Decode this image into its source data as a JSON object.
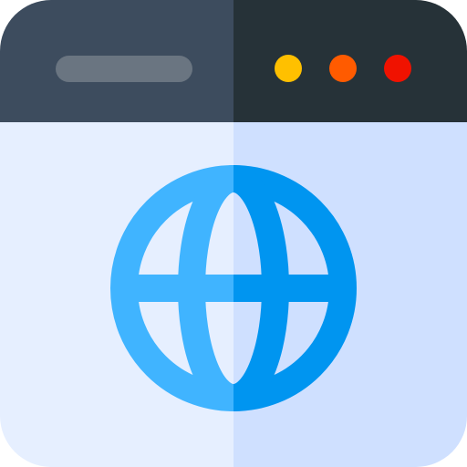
{
  "icon": {
    "name": "web-browser-globe-icon",
    "colors": {
      "titlebar_left": "#3d4c5e",
      "titlebar_right": "#263238",
      "address_bar": "#6a7581",
      "window_dot_yellow": "#ffc000",
      "window_dot_orange": "#ff5b00",
      "window_dot_red": "#f01200",
      "content_left": "#e6efff",
      "content_right": "#cfe0ff",
      "globe_left": "#40b4ff",
      "globe_right": "#0095f0"
    }
  }
}
